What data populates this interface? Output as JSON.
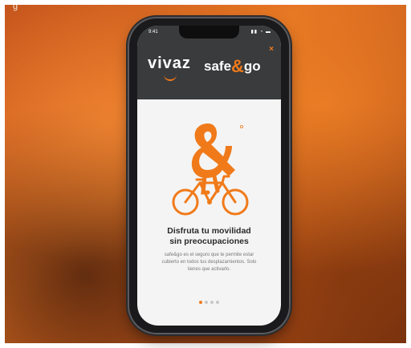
{
  "corner_text": "g",
  "status_bar": {
    "time": "9:41",
    "icons": "▮▮ ◔ ▬"
  },
  "header": {
    "brand_left": "vivaz",
    "brand_right_a": "safe",
    "brand_right_amp": "&",
    "brand_right_b": "go",
    "close_symbol": "×"
  },
  "content": {
    "headline_line1": "Disfruta tu movilidad",
    "headline_line2": "sin preocupaciones",
    "body_line1": "safe&go es el seguro que te permite estar",
    "body_line2": "cubierto en todos tus desplazamientos. Solo",
    "body_line3": "tienes que activarlo."
  },
  "pager": {
    "total": 4,
    "active_index": 0
  },
  "colors": {
    "accent": "#f07a1a",
    "header_bg": "#3a3b3d",
    "screen_bg": "#f4f4f4"
  },
  "icons": {
    "illustration": "ampersand-cyclist-icon",
    "close": "close-icon"
  }
}
